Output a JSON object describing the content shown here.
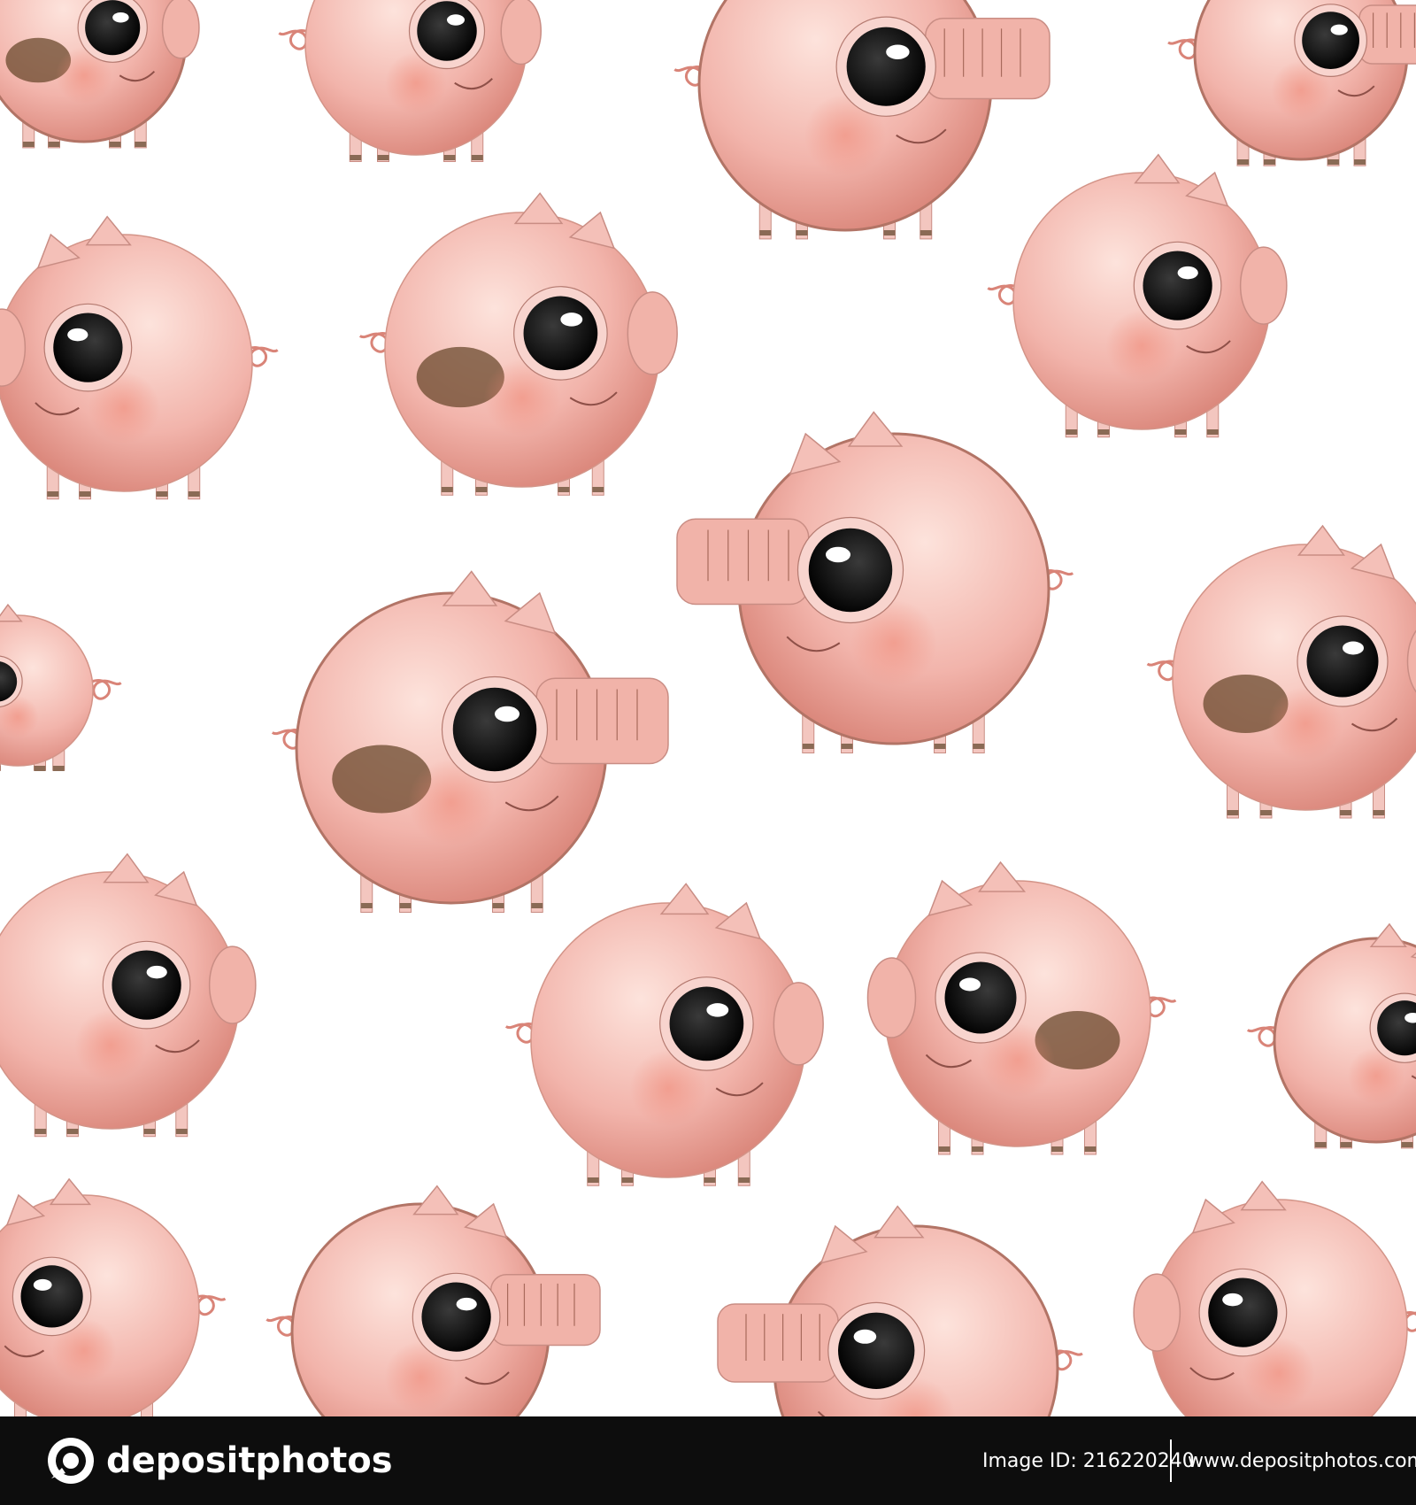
{
  "colors": {
    "background": "#ffffff",
    "pig_skin": "#f2b4ab",
    "pig_shade": "#e0887c",
    "mud": "#6b4a2e",
    "eye": "#111111",
    "footer": "#0d0d0d"
  },
  "illustration": {
    "pigs": [
      {
        "dir": "right",
        "spot": true,
        "hairy": true,
        "snout": "round"
      },
      {
        "dir": "right",
        "spot": false,
        "hairy": false,
        "snout": "round"
      },
      {
        "dir": "right",
        "spot": false,
        "hairy": true,
        "snout": "long"
      },
      {
        "dir": "right",
        "spot": false,
        "hairy": true,
        "snout": "long"
      },
      {
        "dir": "left",
        "spot": false,
        "hairy": false,
        "snout": "round"
      },
      {
        "dir": "right",
        "spot": true,
        "hairy": false,
        "snout": "round"
      },
      {
        "dir": "right",
        "spot": false,
        "hairy": false,
        "snout": "round"
      },
      {
        "dir": "left",
        "spot": false,
        "hairy": true,
        "snout": "long"
      },
      {
        "dir": "right",
        "spot": true,
        "hairy": true,
        "snout": "long"
      },
      {
        "dir": "right",
        "spot": true,
        "hairy": false,
        "snout": "round"
      },
      {
        "dir": "right",
        "spot": false,
        "hairy": false,
        "snout": "round"
      },
      {
        "dir": "right",
        "spot": false,
        "hairy": false,
        "snout": "round"
      },
      {
        "dir": "left",
        "spot": true,
        "hairy": false,
        "snout": "round"
      },
      {
        "dir": "right",
        "spot": false,
        "hairy": true,
        "snout": "round"
      },
      {
        "dir": "left",
        "spot": false,
        "hairy": false,
        "snout": "round"
      },
      {
        "dir": "right",
        "spot": false,
        "hairy": true,
        "snout": "long"
      },
      {
        "dir": "left",
        "spot": false,
        "hairy": true,
        "snout": "long"
      },
      {
        "dir": "left",
        "spot": false,
        "hairy": false,
        "snout": "round"
      },
      {
        "dir": "left",
        "spot": false,
        "hairy": false,
        "snout": "round"
      }
    ]
  },
  "footer": {
    "brand": "depositphotos",
    "image_id": "Image ID: 216220240",
    "site": "www.depositphotos.com"
  }
}
